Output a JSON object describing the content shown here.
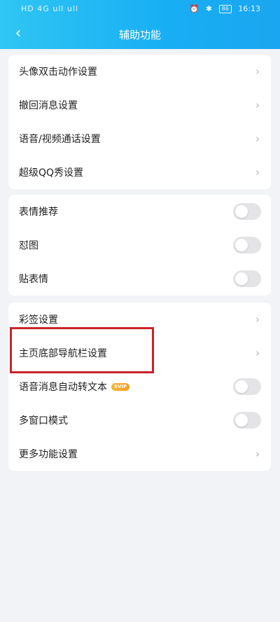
{
  "status": {
    "left": "HD 4G ull ull",
    "time": "16:13",
    "battery": "86"
  },
  "header": {
    "title": "辅助功能",
    "back_icon": "back-chevron-icon"
  },
  "group1": {
    "items": [
      {
        "label": "头像双击动作设置"
      },
      {
        "label": "撤回消息设置"
      },
      {
        "label": "语音/视频通话设置"
      },
      {
        "label": "超级QQ秀设置"
      }
    ]
  },
  "group2": {
    "items": [
      {
        "label": "表情推荐",
        "checked": false
      },
      {
        "label": "怼图",
        "checked": false
      },
      {
        "label": "贴表情",
        "checked": false
      }
    ]
  },
  "group3": {
    "items": [
      {
        "label": "彩签设置"
      },
      {
        "label": "主页底部导航栏设置"
      },
      {
        "label": "语音消息自动转文本",
        "badge": "SVIP",
        "checked": false
      },
      {
        "label": "多窗口模式",
        "checked": false
      },
      {
        "label": "更多功能设置"
      }
    ]
  },
  "colors": {
    "header": "#18aef4",
    "highlight": "#c8232c"
  }
}
